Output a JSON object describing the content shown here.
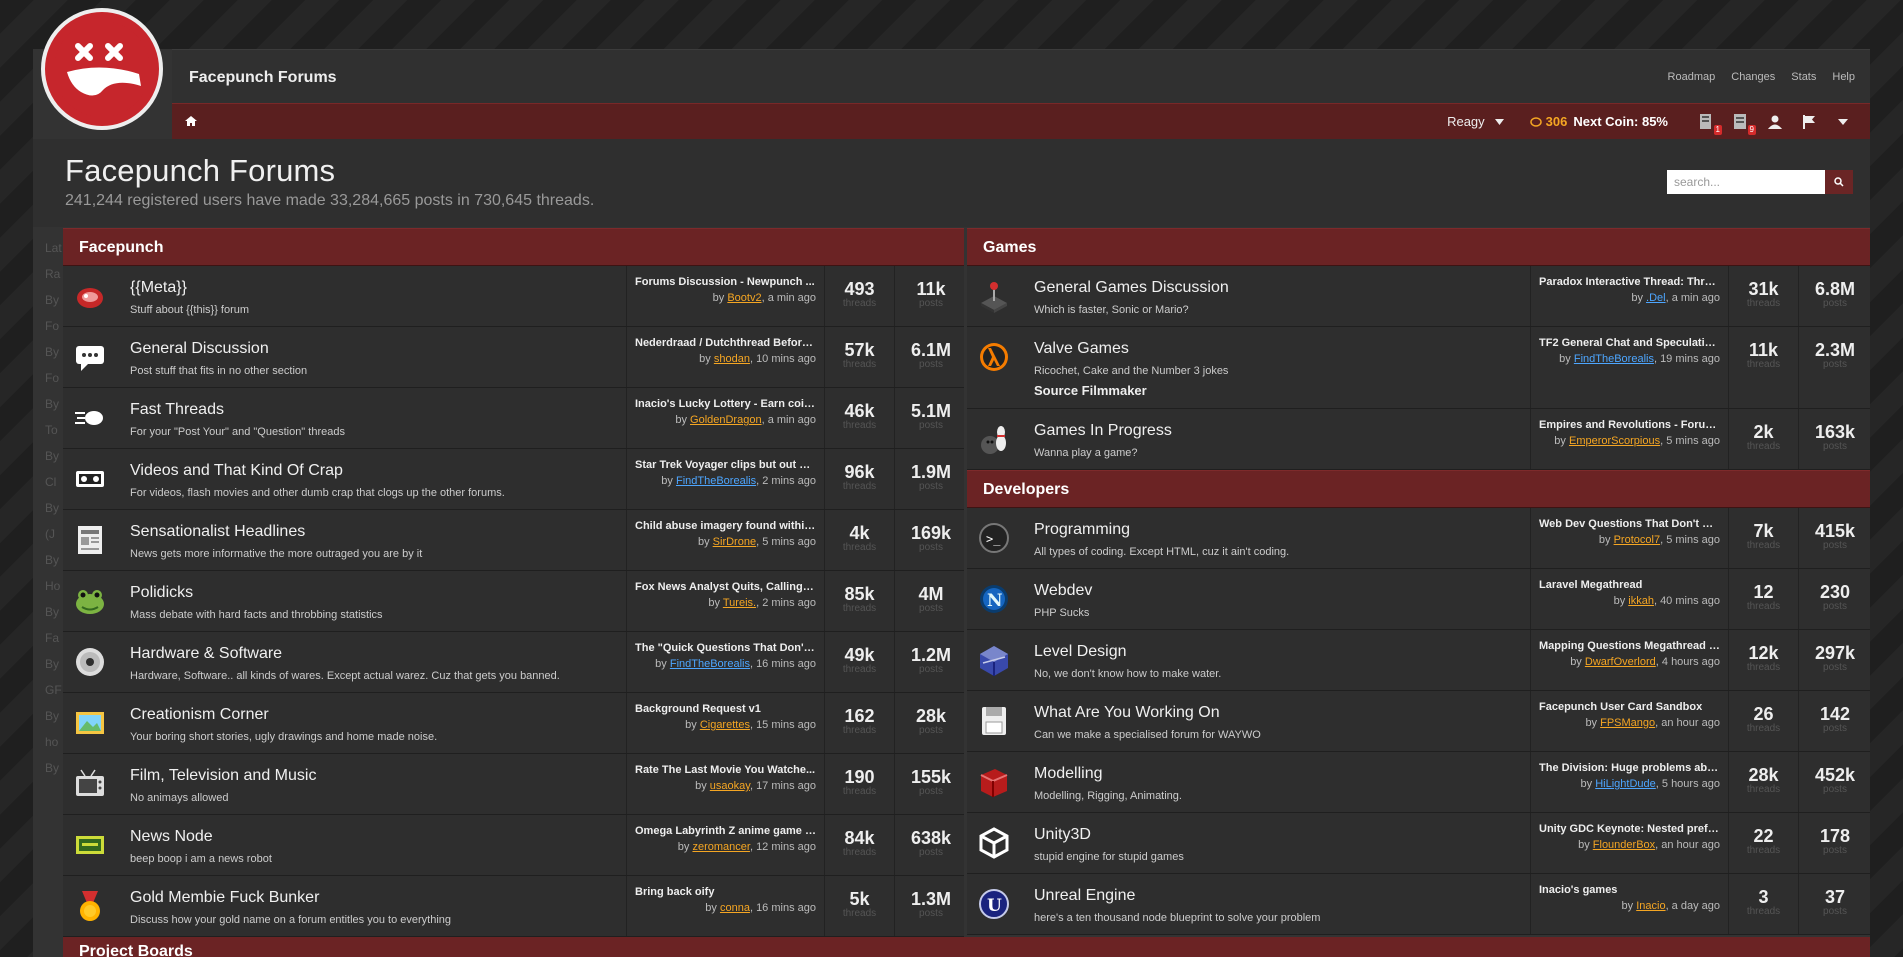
{
  "site_name": "Facepunch Forums",
  "top_links": [
    "Roadmap",
    "Changes",
    "Stats",
    "Help"
  ],
  "nav": {
    "username": "Reagy",
    "coins": "306",
    "next_coin": "Next Coin: 85%",
    "badge_a": "1",
    "badge_b": "9"
  },
  "header": {
    "title": "Facepunch Forums",
    "subtitle": "241,244 registered users have made 33,284,665 posts in 730,645 threads.",
    "search_placeholder": "search..."
  },
  "sidebar_ghost": [
    "Lat",
    "Ra",
    "By",
    "Fo",
    "By",
    "Fo",
    "By",
    "To",
    "By",
    "Cl",
    "By",
    "(J",
    "By",
    "Ho",
    "By",
    "Fa",
    "By",
    "GF",
    "By",
    "ho",
    "By"
  ],
  "stat_labels": {
    "threads": "threads",
    "posts": "posts",
    "by": "by"
  },
  "left_category": "Facepunch",
  "left_forums": [
    {
      "icon": "meat-icon",
      "name": "{{Meta}}",
      "desc": "Stuff about {{this}} forum",
      "last_title": "Forums Discussion - Newpunch ...",
      "last_user": "Bootv2",
      "last_time": ", a min ago",
      "user_color": "#f5a623",
      "threads": "493",
      "posts": "11k"
    },
    {
      "icon": "speech-bubble-icon",
      "name": "General Discussion",
      "desc": "Post stuff that fits in no other section",
      "last_title": "Nederdraad / Dutchthread Before ...",
      "last_user": "shodan",
      "last_time": ", 10 mins ago",
      "user_color": "#f5a623",
      "threads": "57k",
      "posts": "6.1M"
    },
    {
      "icon": "fast-hand-icon",
      "name": "Fast Threads",
      "desc": "For your \"Post Your\" and \"Question\" threads",
      "last_title": "Inacio's Lucky Lottery - Earn coins...",
      "last_user": "GoldenDragon",
      "last_time": ", a min ago",
      "user_color": "#f5a623",
      "threads": "46k",
      "posts": "5.1M"
    },
    {
      "icon": "videotape-icon",
      "name": "Videos and That Kind Of Crap",
      "desc": "For videos, flash movies and other dumb crap that clogs up the other forums.",
      "last_title": "Star Trek Voyager clips but out of ...",
      "last_user": "FindTheBorealis",
      "last_time": ", 2 mins ago",
      "user_color": "#4da6ff",
      "threads": "96k",
      "posts": "1.9M"
    },
    {
      "icon": "newspaper-icon",
      "name": "Sensationalist Headlines",
      "desc": "News gets more informative the more outraged you are by it",
      "last_title": "Child abuse imagery found within...",
      "last_user": "SirDrone",
      "last_time": ", 5 mins ago",
      "user_color": "#f5a623",
      "threads": "4k",
      "posts": "169k"
    },
    {
      "icon": "frog-icon",
      "name": "Polidicks",
      "desc": "Mass debate with hard facts and throbbing statistics",
      "last_title": "Fox News Analyst Quits, Calling N...",
      "last_user": "Tureis.",
      "last_time": ", 2 mins ago",
      "user_color": "#f5a623",
      "threads": "85k",
      "posts": "4M"
    },
    {
      "icon": "disc-icon",
      "name": "Hardware & Software",
      "desc": "Hardware, Software.. all kinds of wares. Except actual warez. Cuz that gets you banned.",
      "last_title": "The \"Quick Questions That Don't ...",
      "last_user": "FindTheBorealis",
      "last_time": ", 16 mins ago",
      "user_color": "#4da6ff",
      "threads": "49k",
      "posts": "1.2M"
    },
    {
      "icon": "painting-icon",
      "name": "Creationism Corner",
      "desc": "Your boring short stories, ugly drawings and home made noise.",
      "last_title": "Background Request v1",
      "last_user": "Cigarettes",
      "last_time": ", 15 mins ago",
      "user_color": "#f5a623",
      "threads": "162",
      "posts": "28k"
    },
    {
      "icon": "tv-icon",
      "name": "Film, Television and Music",
      "desc": "No animays allowed",
      "last_title": "Rate The Last Movie You Watche...",
      "last_user": "usaokay",
      "last_time": ", 17 mins ago",
      "user_color": "#f5a623",
      "threads": "190",
      "posts": "155k"
    },
    {
      "icon": "news-robot-icon",
      "name": "News Node",
      "desc": "beep boop i am a news robot",
      "last_title": "Omega Labyrinth Z anime game b...",
      "last_user": "zeromancer",
      "last_time": ", 12 mins ago",
      "user_color": "#f5a623",
      "threads": "84k",
      "posts": "638k"
    },
    {
      "icon": "gold-medal-icon",
      "name": "Gold Membie Fuck Bunker",
      "desc": "Discuss how your gold name on a forum entitles you to everything",
      "last_title": "Bring back oify",
      "last_user": "conna",
      "last_time": ", 16 mins ago",
      "user_color": "#f5a623",
      "threads": "5k",
      "posts": "1.3M"
    }
  ],
  "games_category": "Games",
  "games_forums": [
    {
      "icon": "joystick-icon",
      "name": "General Games Discussion",
      "desc": "Which is faster, Sonic or Mario?",
      "last_title": "Paradox Interactive Thread: Threa...",
      "last_user": ".Del",
      "last_time": ", a min ago",
      "user_color": "#4da6ff",
      "threads": "31k",
      "posts": "6.8M"
    },
    {
      "icon": "half-life-icon",
      "name": "Valve Games",
      "desc": "Ricochet, Cake and the Number 3 jokes",
      "subforum": "Source Filmmaker",
      "last_title": "TF2 General Chat and Speculatio...",
      "last_user": "FindTheBorealis",
      "last_time": ", 19 mins ago",
      "user_color": "#4da6ff",
      "threads": "11k",
      "posts": "2.3M"
    },
    {
      "icon": "bowling-icon",
      "name": "Games In Progress",
      "desc": "Wanna play a game?",
      "last_title": "Empires and Revolutions - Forum ...",
      "last_user": "EmperorScorpious",
      "last_time": ", 5 mins ago",
      "user_color": "#f5a623",
      "threads": "2k",
      "posts": "163k"
    }
  ],
  "dev_category": "Developers",
  "dev_forums": [
    {
      "icon": "terminal-icon",
      "name": "Programming",
      "desc": "All types of coding. Except HTML, cuz it ain't coding.",
      "last_title": "Web Dev Questions That Don't Ne...",
      "last_user": "Protocol7",
      "last_time": ", 5 mins ago",
      "user_color": "#f5a623",
      "threads": "7k",
      "posts": "415k"
    },
    {
      "icon": "netscape-icon",
      "name": "Webdev",
      "desc": "PHP Sucks",
      "last_title": "Laravel Megathread",
      "last_user": "ikkah",
      "last_time": ", 40 mins ago",
      "user_color": "#f5a623",
      "threads": "12",
      "posts": "230"
    },
    {
      "icon": "cube-icon",
      "name": "Level Design",
      "desc": "No, we don't know how to make water.",
      "last_title": "Mapping Questions Megathread V6",
      "last_user": "DwarfOverlord",
      "last_time": ", 4 hours ago",
      "user_color": "#f5a623",
      "threads": "12k",
      "posts": "297k"
    },
    {
      "icon": "floppy-icon",
      "name": "What Are You Working On",
      "desc": "Can we make a specialised forum for WAYWO",
      "last_title": "Facepunch User Card Sandbox",
      "last_user": "FPSMango",
      "last_time": ", an hour ago",
      "user_color": "#f5a623",
      "threads": "26",
      "posts": "142"
    },
    {
      "icon": "model-icon",
      "name": "Modelling",
      "desc": "Modelling, Rigging, Animating.",
      "last_title": "The Division: Huge problems abo...",
      "last_user": "HiLightDude",
      "last_time": ", 5 hours ago",
      "user_color": "#4da6ff",
      "threads": "28k",
      "posts": "452k"
    },
    {
      "icon": "unity-icon",
      "name": "Unity3D",
      "desc": "stupid engine for stupid games",
      "last_title": "Unity GDC Keynote: Nested prefa...",
      "last_user": "FlounderBox",
      "last_time": ", an hour ago",
      "user_color": "#f5a623",
      "threads": "22",
      "posts": "178"
    },
    {
      "icon": "unreal-icon",
      "name": "Unreal Engine",
      "desc": "here's a ten thousand node blueprint to solve your problem",
      "last_title": "Inacio's games",
      "last_user": "Inacio",
      "last_time": ", a day ago",
      "user_color": "#f5a623",
      "threads": "3",
      "posts": "37"
    }
  ],
  "project_category": "Project Boards",
  "colors": {
    "accent": "#6b2324",
    "gold_user": "#f5a623",
    "blue_user": "#4da6ff",
    "coin": "#f5a623"
  }
}
